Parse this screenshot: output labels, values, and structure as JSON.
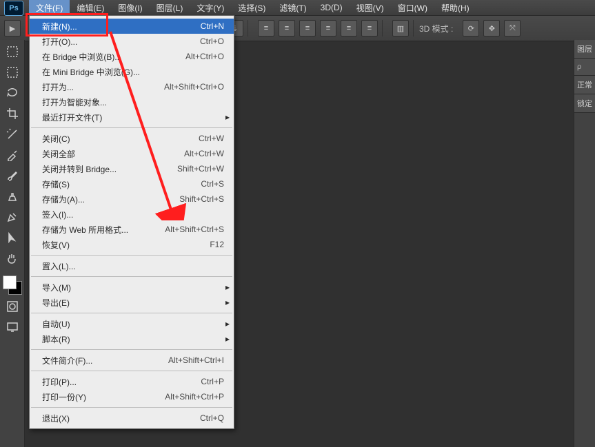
{
  "app": {
    "logo": "Ps"
  },
  "menu": {
    "file": "文件(F)",
    "edit": "编辑(E)",
    "image": "图像(I)",
    "layer": "图层(L)",
    "type": "文字(Y)",
    "select": "选择(S)",
    "filter": "滤镜(T)",
    "_3d": "3D(D)",
    "view": "视图(V)",
    "window": "窗口(W)",
    "help": "帮助(H)"
  },
  "options": {
    "mode3d_label": "3D 模式 :"
  },
  "dropdown": {
    "new": {
      "label": "新建(N)...",
      "shortcut": "Ctrl+N"
    },
    "open": {
      "label": "打开(O)...",
      "shortcut": "Ctrl+O"
    },
    "browse_bridge": {
      "label": "在 Bridge 中浏览(B)...",
      "shortcut": "Alt+Ctrl+O"
    },
    "browse_minibridge": {
      "label": "在 Mini Bridge 中浏览(G)..."
    },
    "open_as": {
      "label": "打开为...",
      "shortcut": "Alt+Shift+Ctrl+O"
    },
    "open_smart": {
      "label": "打开为智能对象..."
    },
    "open_recent": {
      "label": "最近打开文件(T)"
    },
    "close": {
      "label": "关闭(C)",
      "shortcut": "Ctrl+W"
    },
    "close_all": {
      "label": "关闭全部",
      "shortcut": "Alt+Ctrl+W"
    },
    "close_goto_bridge": {
      "label": "关闭并转到 Bridge...",
      "shortcut": "Shift+Ctrl+W"
    },
    "save": {
      "label": "存储(S)",
      "shortcut": "Ctrl+S"
    },
    "save_as": {
      "label": "存储为(A)...",
      "shortcut": "Shift+Ctrl+S"
    },
    "check_in": {
      "label": "签入(I)..."
    },
    "save_for_web": {
      "label": "存储为 Web 所用格式...",
      "shortcut": "Alt+Shift+Ctrl+S"
    },
    "revert": {
      "label": "恢复(V)",
      "shortcut": "F12"
    },
    "place": {
      "label": "置入(L)..."
    },
    "import": {
      "label": "导入(M)"
    },
    "export": {
      "label": "导出(E)"
    },
    "automate": {
      "label": "自动(U)"
    },
    "scripts": {
      "label": "脚本(R)"
    },
    "file_info": {
      "label": "文件简介(F)...",
      "shortcut": "Alt+Shift+Ctrl+I"
    },
    "print": {
      "label": "打印(P)...",
      "shortcut": "Ctrl+P"
    },
    "print_one": {
      "label": "打印一份(Y)",
      "shortcut": "Alt+Shift+Ctrl+P"
    },
    "exit": {
      "label": "退出(X)",
      "shortcut": "Ctrl+Q"
    },
    "submenu_arrow": "▸"
  },
  "right_panel": {
    "layers_tab": "图层",
    "search_placeholder": "ρ",
    "normal": "正常",
    "lock": "锁定"
  }
}
